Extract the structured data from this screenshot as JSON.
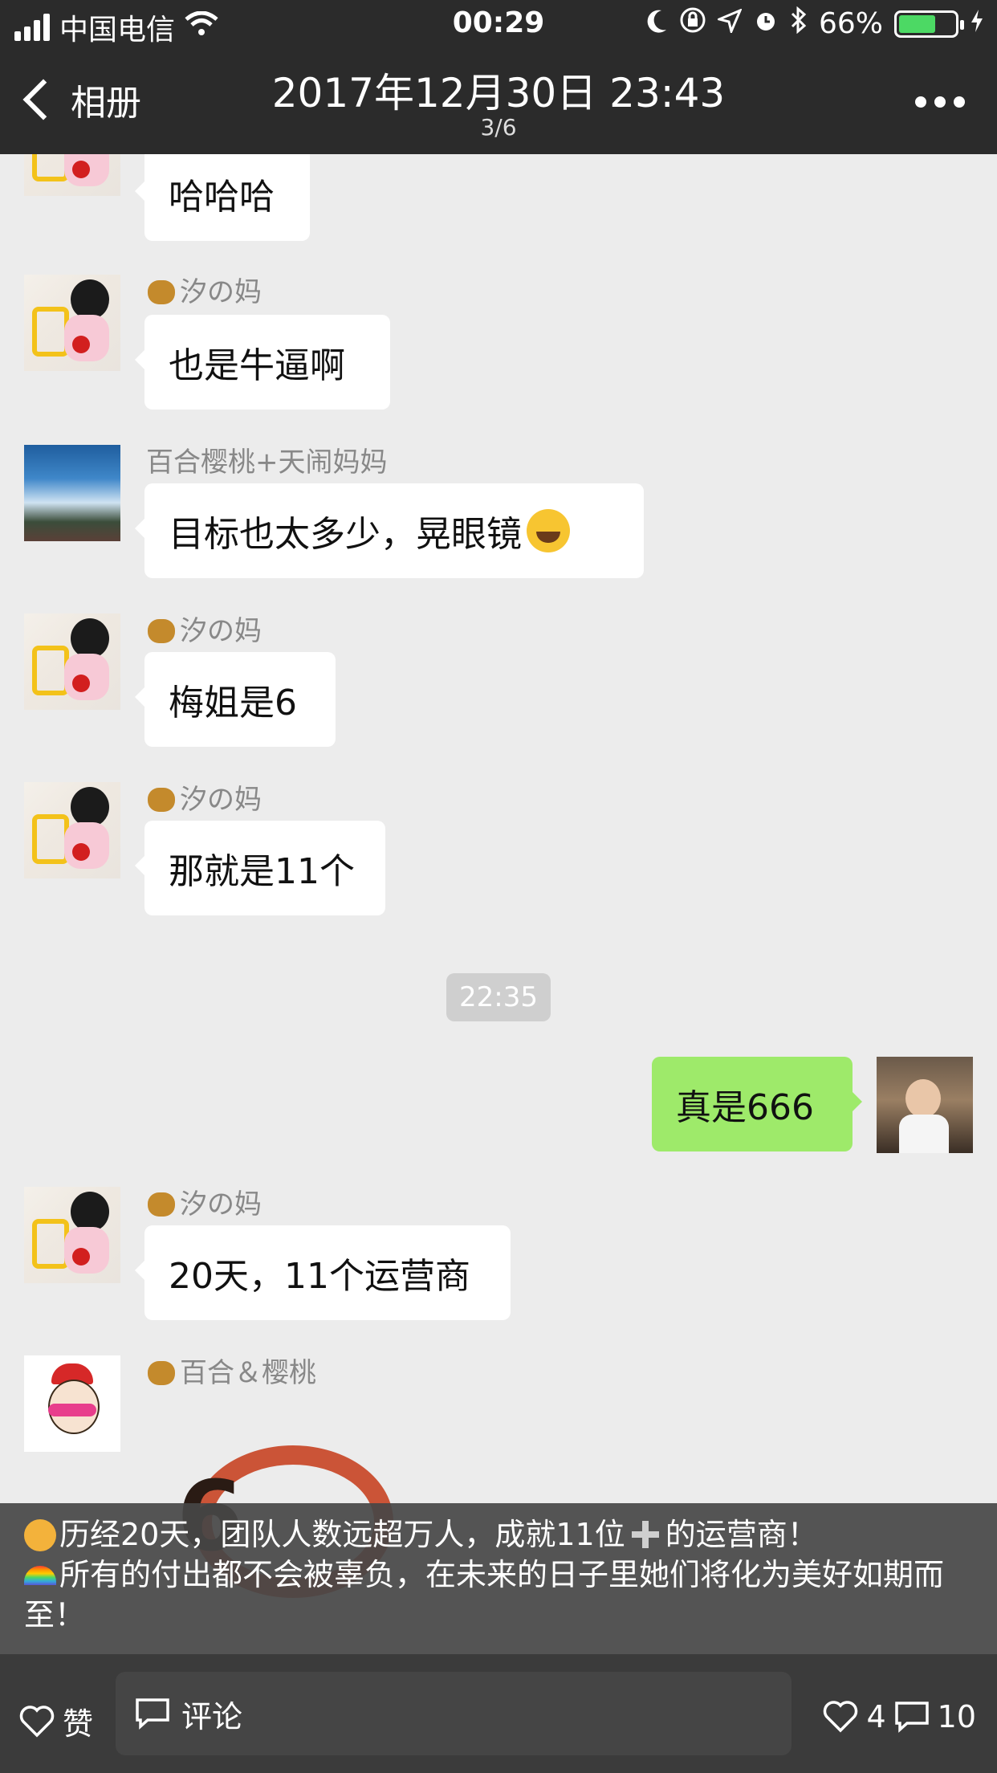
{
  "statusbar": {
    "carrier": "中国电信",
    "time": "00:29",
    "battery": "66%",
    "battery_level": 0.66
  },
  "navbar": {
    "back_label": "相册",
    "title": "2017年12月30日 23:43",
    "subtitle": "3/6"
  },
  "chat": {
    "messages": [
      {
        "text": "哈哈哈"
      },
      {
        "sender": "汐の妈",
        "text": "也是牛逼啊"
      },
      {
        "sender": "百合樱桃+天闹妈妈",
        "text": "目标也太多少，晃眼镜"
      },
      {
        "sender": "汐の妈",
        "text": "梅姐是6"
      },
      {
        "sender": "汐の妈",
        "text": "那就是11个"
      },
      {
        "text": "真是666"
      },
      {
        "sender": "汐の妈",
        "text": "20天，11个运营商"
      },
      {
        "sender": "百合＆樱桃"
      }
    ],
    "timestamp": "22:35"
  },
  "caption": {
    "line1_a": "历经20天，团队人数远超万人，成就11位",
    "line1_b": "的运营商！",
    "line2": "所有的付出都不会被辜负，在未来的日子里她们将化为美好如期而至！"
  },
  "bottombar": {
    "like_label": "赞",
    "comment_label": "评论",
    "like_count": "4",
    "comment_count": "10"
  },
  "icons": {
    "like": "heart-icon",
    "comment": "comment-icon",
    "more": "more-icon",
    "back": "chevron-left-icon"
  }
}
